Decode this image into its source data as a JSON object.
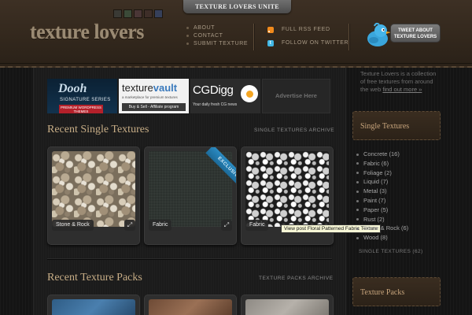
{
  "header": {
    "top_tab": "TEXTURE LOVERS UNITE",
    "logo": "texture lovers",
    "swatches": [
      "#3a3a35",
      "#3b4a38",
      "#4a3636",
      "#3e2e28",
      "#36405a"
    ],
    "nav": [
      "ABOUT",
      "CONTACT",
      "SUBMIT TEXTURE"
    ],
    "feeds": {
      "rss": "FULL RSS FEED",
      "twitter": "FOLLOW ON TWITTER"
    },
    "tweet_button": "TWEET ABOUT TEXTURE LOVERS"
  },
  "ads": {
    "dooh": {
      "title": "Dooh",
      "subtitle": "SIGNATURE SERIES",
      "tag": "PREMIUM WORDPRESS THEMES"
    },
    "texturevault": {
      "title_a": "texture",
      "title_b": "vault",
      "tagline": "a marketplace for premium textures",
      "strip": "Buy & Sell - Affiliate program"
    },
    "cgdigg": {
      "title": "CGDigg",
      "tagline": "Your daily fresh CG news"
    },
    "advertise": "Advertise Here"
  },
  "singles": {
    "title": "Recent Single Textures",
    "archive": "SINGLE TEXTURES ARCHIVE",
    "items": [
      {
        "label": "Stone & Rock"
      },
      {
        "label": "Fabric",
        "ribbon": "EXCLUSIVE"
      },
      {
        "label": "Fabric"
      }
    ],
    "tooltip": "View post Floral Patterned Fabric Texture"
  },
  "packs": {
    "title": "Recent Texture Packs",
    "archive": "TEXTURE PACKS ARCHIVE"
  },
  "sidebar": {
    "intro": "Texture Lovers is a collection of free textures from around the web ",
    "intro_link": "find out more »",
    "single_title": "Single Textures",
    "categories": [
      "Concrete (16)",
      "Fabric (6)",
      "Foliage (2)",
      "Liquid (7)",
      "Metal (3)",
      "Paint (7)",
      "Paper (5)",
      "Rust (2)",
      "Stone & Rock (6)",
      "Wood (8)"
    ],
    "single_archive": "SINGLE TEXTURES (62)",
    "packs_title": "Texture Packs"
  }
}
